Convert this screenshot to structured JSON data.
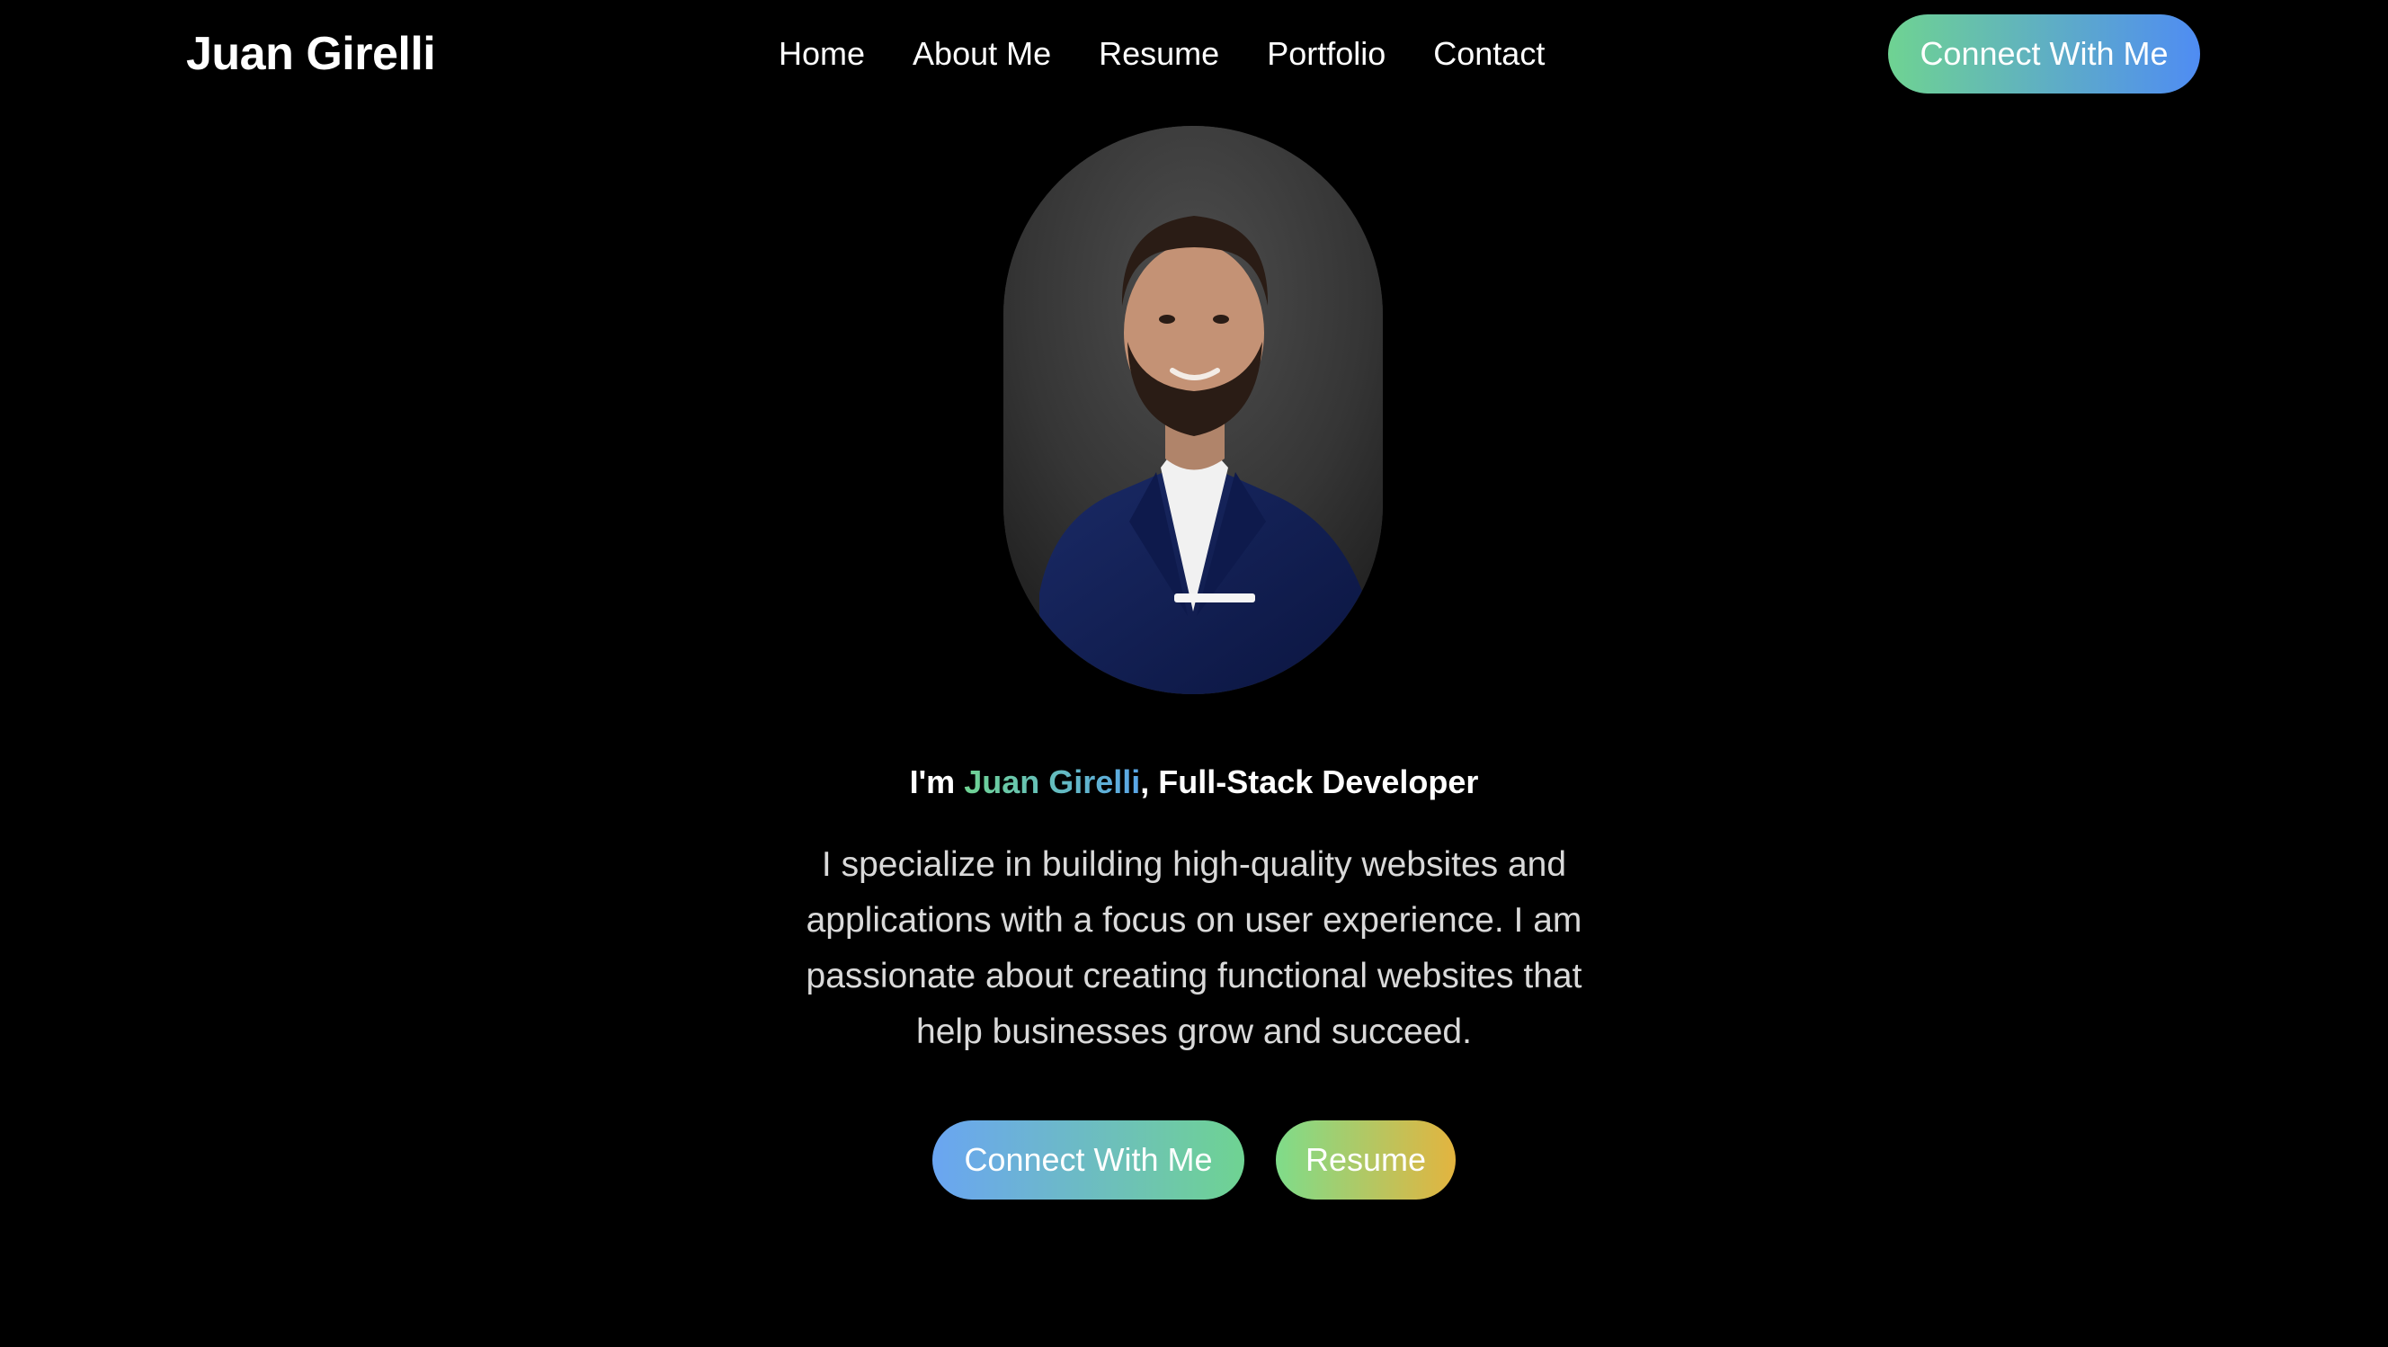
{
  "header": {
    "brand": "Juan Girelli",
    "nav": [
      {
        "label": "Home"
      },
      {
        "label": "About Me"
      },
      {
        "label": "Resume"
      },
      {
        "label": "Portfolio"
      },
      {
        "label": "Contact"
      }
    ],
    "cta_label": "Connect With Me"
  },
  "hero": {
    "portrait_icon": "profile-photo",
    "headline_prefix": "I'm ",
    "headline_name": "Juan Girelli",
    "headline_suffix": ", Full-Stack Developer",
    "intro": "I specialize in building high-quality websites and applications with a focus on user experience. I am passionate about creating functional websites that help businesses grow and succeed.",
    "buttons": {
      "connect_label": "Connect With Me",
      "resume_label": "Resume"
    }
  },
  "colors": {
    "background": "#000000",
    "text": "#ffffff",
    "muted_text": "#d9d9d9",
    "accent_green": "#6fd392",
    "accent_blue": "#4f8cf3",
    "accent_gold": "#e3b43f"
  }
}
